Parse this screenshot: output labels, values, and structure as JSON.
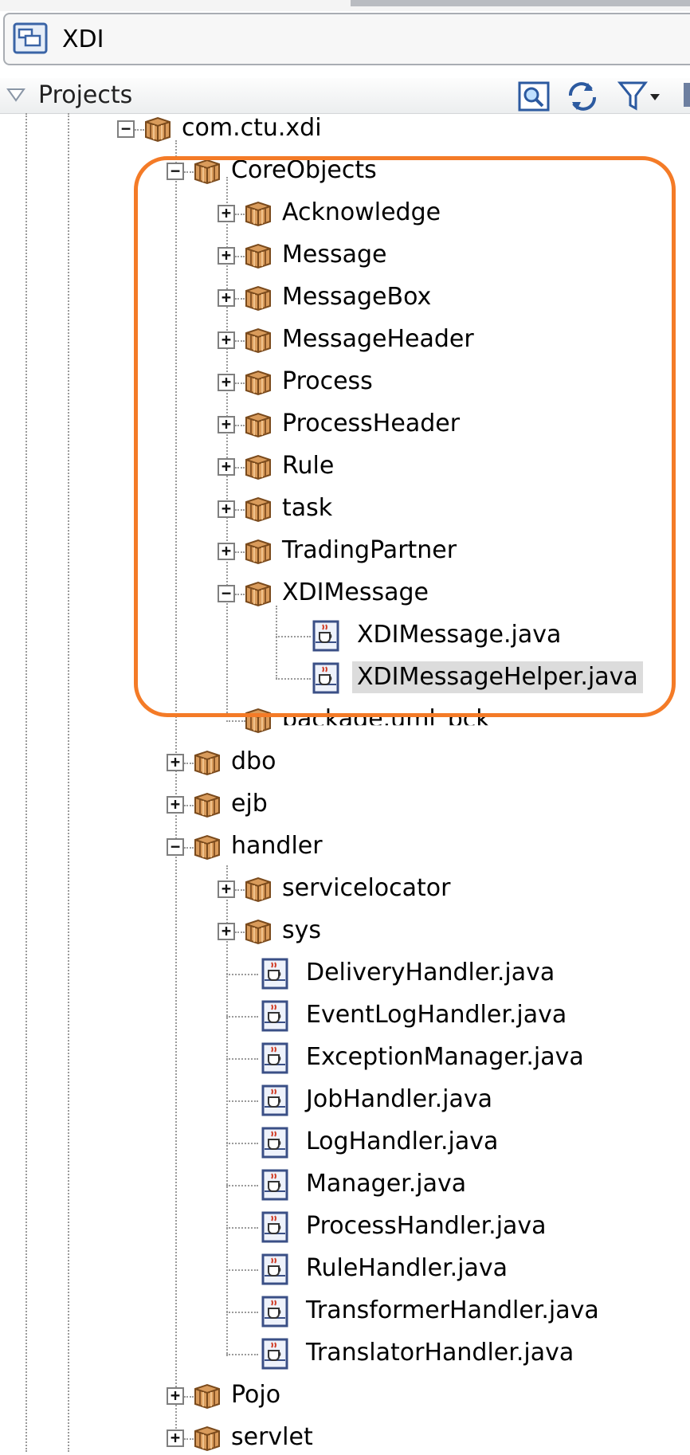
{
  "window": {
    "title": "XDI"
  },
  "panel": {
    "title": "Projects"
  },
  "tree": {
    "root": "com.ctu.xdi",
    "core_objects": {
      "label": "CoreObjects",
      "children": [
        "Acknowledge",
        "Message",
        "MessageBox",
        "MessageHeader",
        "Process",
        "ProcessHeader",
        "Rule",
        "task",
        "TradingPartner"
      ],
      "xdimessage": {
        "label": "XDIMessage",
        "files": [
          "XDIMessage.java",
          "XDIMessageHelper.java"
        ]
      },
      "partial_item": "package.uml_pck"
    },
    "dbo": "dbo",
    "ejb": "ejb",
    "handler": {
      "label": "handler",
      "packages": [
        "servicelocator",
        "sys"
      ],
      "files": [
        "DeliveryHandler.java",
        "EventLogHandler.java",
        "ExceptionManager.java",
        "JobHandler.java",
        "LogHandler.java",
        "Manager.java",
        "ProcessHandler.java",
        "RuleHandler.java",
        "TransformerHandler.java",
        "TranslatorHandler.java"
      ]
    },
    "pojo": "Pojo",
    "servlet": "servlet"
  },
  "colors": {
    "highlight": "#f47b27",
    "package": "#c8813f",
    "selection": "#dcdcdc"
  },
  "icons": [
    "window-icon",
    "search-icon",
    "sync-icon",
    "filter-icon",
    "package-icon",
    "java-file-icon"
  ]
}
